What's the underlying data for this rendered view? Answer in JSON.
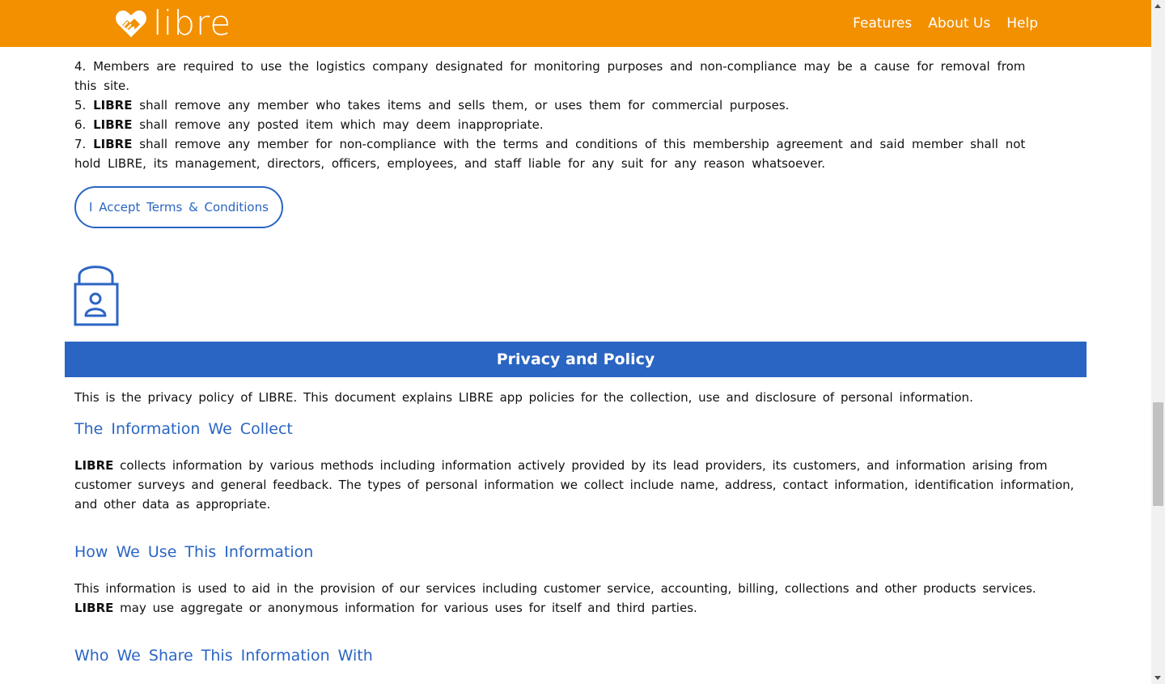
{
  "header": {
    "brand": "libre",
    "nav": [
      "Features",
      "About Us",
      "Help"
    ]
  },
  "terms": {
    "items": [
      {
        "num": "4.",
        "bold": "",
        "text": "Members are required to use the logistics company designated for monitoring purposes and non-compliance may be a cause for removal from this site."
      },
      {
        "num": "5.",
        "bold": "LIBRE",
        "text": "shall remove any member who takes items and sells them, or uses them for commercial purposes."
      },
      {
        "num": "6.",
        "bold": "LIBRE",
        "text": "shall remove any posted item which may deem inappropriate."
      },
      {
        "num": "7.",
        "bold": "LIBRE",
        "text": "shall remove any member for non-compliance with the terms and conditions of this membership agreement and said member shall not hold LIBRE, its management, directors, officers, employees, and staff liable for any suit for any reason whatsoever."
      }
    ],
    "accept_button": "I Accept Terms & Conditions"
  },
  "privacy": {
    "banner_title": "Privacy and Policy",
    "intro": "This is the privacy policy of LIBRE. This document explains LIBRE app policies for the collection, use and disclosure of personal information.",
    "sections": [
      {
        "heading": "The Information We Collect",
        "body_bold": "LIBRE",
        "body_pre": "",
        "body": "collects information by various methods including information actively provided by its lead providers, its customers, and information arising from customer surveys and general feedback. The types of personal information we collect include name, address, contact information, identification information, and other data as appropriate."
      },
      {
        "heading": "How We Use This Information",
        "body_pre": "This information is used to aid in the provision of our services including customer service, accounting, billing, collections and other products services.",
        "body_bold": "LIBRE",
        "body": "may use aggregate or anonymous information for various uses for itself and third parties."
      },
      {
        "heading": "Who We Share This Information With"
      }
    ]
  },
  "icons": {
    "logo": "handshake-heart-icon",
    "lock": "lock-user-icon"
  },
  "colors": {
    "header": "#F29000",
    "accent": "#2A65C3"
  }
}
